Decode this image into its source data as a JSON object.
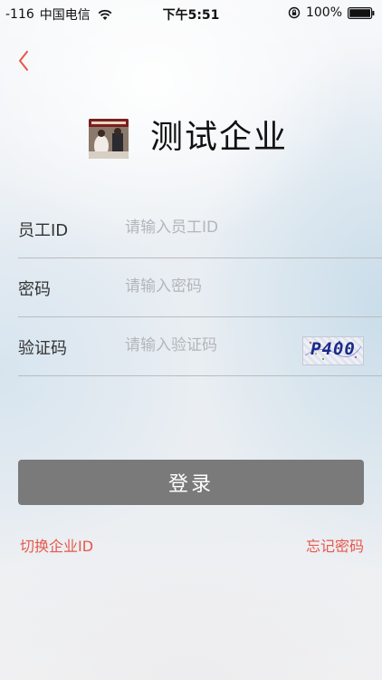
{
  "status_bar": {
    "signal": "-116",
    "carrier": "中国电信",
    "time": "下午5:51",
    "battery": "100%"
  },
  "colors": {
    "accent": "#e8574a",
    "button_bg": "#7a7a7a",
    "divider": "#b8bcc0"
  },
  "header": {
    "company_name": "测试企业"
  },
  "form": {
    "employee_id": {
      "label": "员工ID",
      "placeholder": "请输入员工ID",
      "value": ""
    },
    "password": {
      "label": "密码",
      "placeholder": "请输入密码",
      "value": ""
    },
    "captcha": {
      "label": "验证码",
      "placeholder": "请输入验证码",
      "value": "",
      "image_text": "P400"
    }
  },
  "actions": {
    "login_label": "登录",
    "switch_company_label": "切换企业ID",
    "forgot_password_label": "忘记密码"
  },
  "icons": [
    "wifi-icon",
    "rotation-lock-icon",
    "battery-icon",
    "back-chevron-icon"
  ]
}
